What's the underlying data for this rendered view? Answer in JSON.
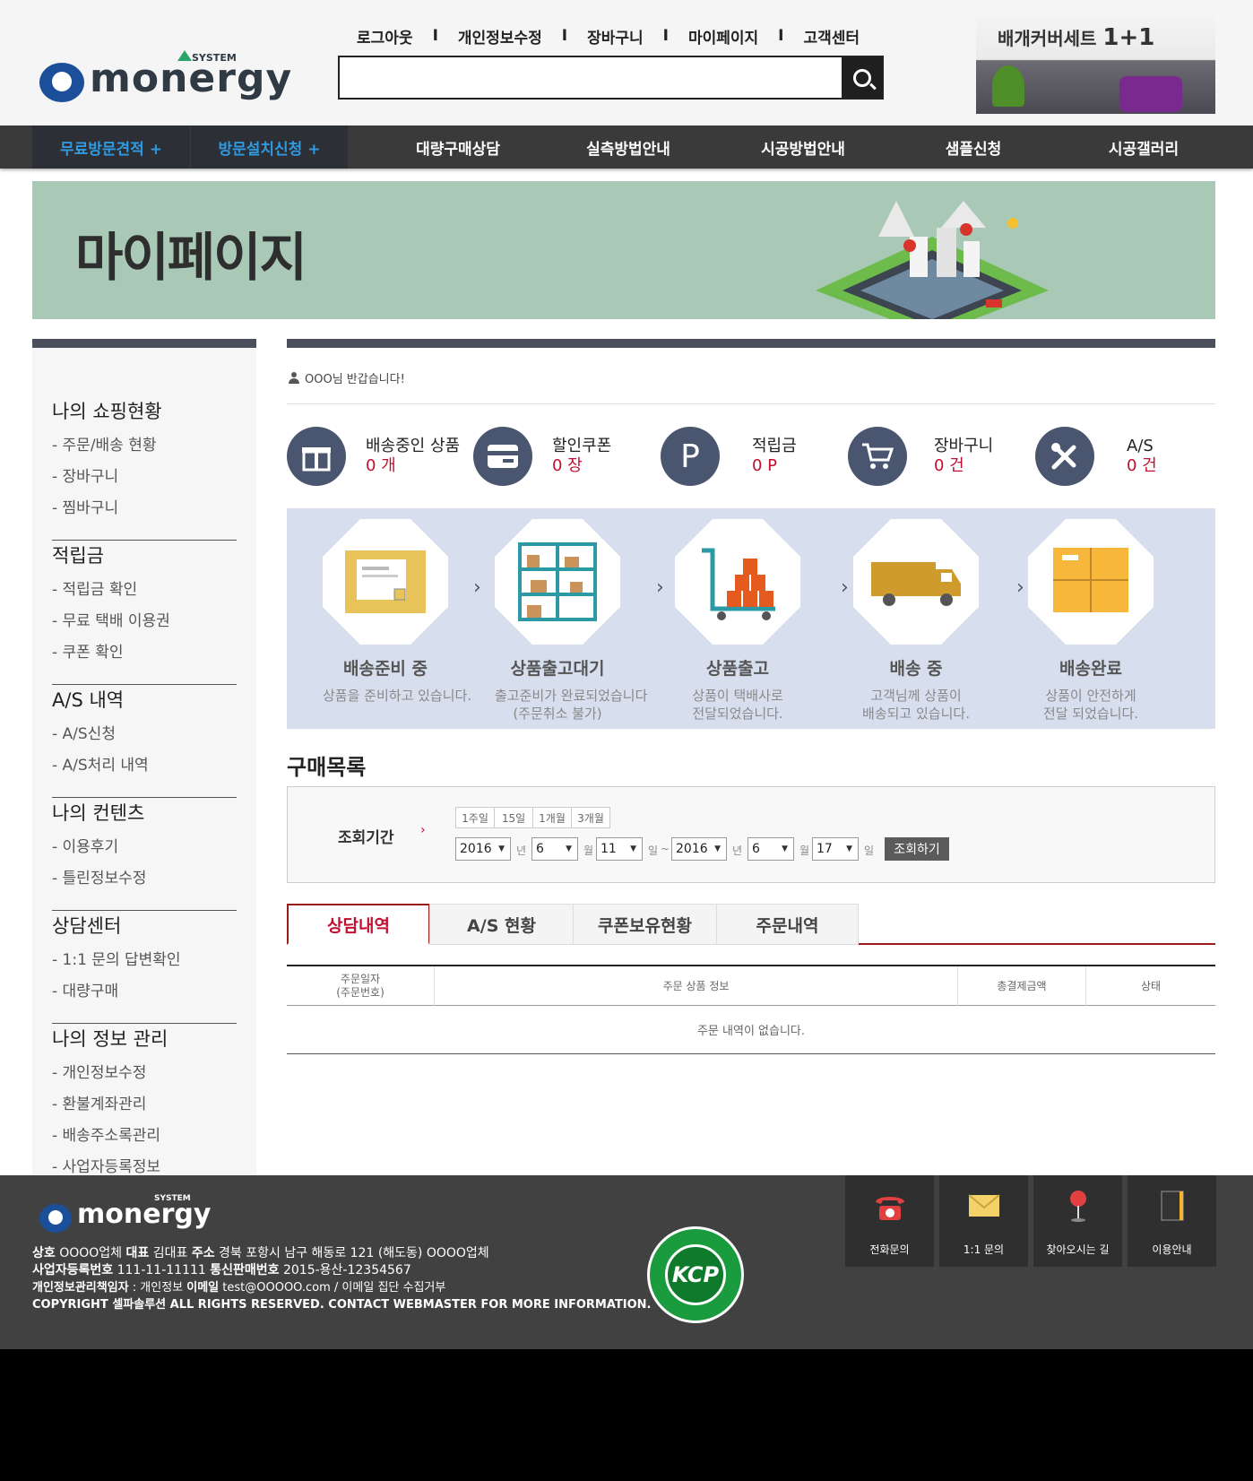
{
  "header": {
    "logo_text": "monergy",
    "logo_badge": "SYSTEM",
    "top_links": [
      "로그아웃",
      "개인정보수정",
      "장바구니",
      "마이페이지",
      "고객센터"
    ],
    "search": {
      "value": "",
      "placeholder": ""
    },
    "ad": {
      "text": "배개커버세트",
      "highlight": "1+1"
    }
  },
  "main_nav": {
    "highlight_items": [
      "무료방문견적 +",
      "방문설치신청 +"
    ],
    "items": [
      "대량구매상담",
      "실측방법안내",
      "시공방법안내",
      "샘플신청",
      "시공갤러리"
    ],
    "highlight_color": "#2f9ae0"
  },
  "banner": {
    "title": "마이페이지"
  },
  "sidebar": {
    "sections": [
      {
        "title": "나의 쇼핑현황",
        "items": [
          "- 주문/배송 현황",
          "- 장바구니",
          "- 찜바구니"
        ]
      },
      {
        "title": "적립금",
        "items": [
          "- 적립금 확인",
          "- 무료 택배 이용권",
          "- 쿠폰 확인"
        ]
      },
      {
        "title": "A/S 내역",
        "items": [
          "- A/S신청",
          "- A/S처리 내역"
        ]
      },
      {
        "title": "나의 컨텐츠",
        "items": [
          "- 이용후기",
          "- 틀린정보수정"
        ]
      },
      {
        "title": "상담센터",
        "items": [
          "- 1:1 문의 답변확인",
          "- 대량구매"
        ]
      },
      {
        "title": "나의 정보 관리",
        "items": [
          "- 개인정보수정",
          "- 환불계좌관리",
          "- 배송주소록관리",
          "- 사업자등록정보"
        ]
      }
    ]
  },
  "welcome": "OOO님 반갑습니다!",
  "stats": [
    {
      "icon": "gift-icon",
      "label": "배송중인 상품",
      "value": "0 개"
    },
    {
      "icon": "card-icon",
      "label": "할인쿠폰",
      "value": "0 장"
    },
    {
      "icon": "points-icon",
      "glyph": "P",
      "label": "적립금",
      "value": "0 P"
    },
    {
      "icon": "cart-icon",
      "label": "장바구니",
      "value": "0 건"
    },
    {
      "icon": "tools-icon",
      "label": "A/S",
      "value": "0 건"
    }
  ],
  "steps": [
    {
      "title": "배송준비 중",
      "desc1": "상품을 준비하고 있습니다.",
      "desc2": ""
    },
    {
      "title": "상품출고대기",
      "desc1": "출고준비가 완료되었습니다",
      "desc2": "(주문취소 불가)"
    },
    {
      "title": "상품출고",
      "desc1": "상품이 택배사로",
      "desc2": "전달되었습니다."
    },
    {
      "title": "배송 중",
      "desc1": "고객님께 상품이",
      "desc2": "배송되고 있습니다."
    },
    {
      "title": "배송완료",
      "desc1": "상품이 안전하게",
      "desc2": "전달 되었습니다."
    }
  ],
  "purchase": {
    "title": "구매목록",
    "filter_label": "조회기간",
    "quick": [
      "1주일",
      "15일",
      "1개월",
      "3개월"
    ],
    "from": {
      "year": "2016",
      "month": "6",
      "day": "11"
    },
    "to": {
      "year": "2016",
      "month": "6",
      "day": "17"
    },
    "units": {
      "year": "년",
      "month": "월",
      "day": "일",
      "tilde": "~"
    },
    "search_btn": "조회하기"
  },
  "tabs": [
    "상담내역",
    "A/S 현황",
    "쿠폰보유현황",
    "주문내역"
  ],
  "table": {
    "headers": [
      "주문일자",
      "(주문번호)",
      "주문 상품 정보",
      "총결제금액",
      "상태"
    ],
    "empty": "주문 내역이 없습니다."
  },
  "footer": {
    "logo_text": "monergy",
    "logo_badge": "SYSTEM",
    "line1_a": "상호",
    "line1_b": " OOOO업체 ",
    "line1_c": "대표",
    "line1_d": " 김대표 ",
    "line1_e": "주소",
    "line1_f": " 경북 포항시 남구 해동로 121 (해도동) OOOO업체",
    "line2_a": "사업자등록번호",
    "line2_b": " 111-11-11111 ",
    "line2_c": "통신판매번호",
    "line2_d": " 2015-용산-12354567",
    "line3_a": "개인정보관리책임자",
    "line3_b": " : 개인정보 ",
    "line3_c": "이메일",
    "line3_d": " test@OOOOO.com / 이메일 집단 수집거부",
    "line4": "COPYRIGHT 셀파솔루션 ALL RIGHTS RESERVED. CONTACT WEBMASTER FOR MORE INFORMATION.",
    "kcp": "KCP",
    "quick_links": [
      {
        "icon": "phone-icon",
        "label": "전화문의"
      },
      {
        "icon": "mail-icon",
        "label": "1:1 문의"
      },
      {
        "icon": "map-pin-icon",
        "label": "찾아오시는 길"
      },
      {
        "icon": "book-icon",
        "label": "이용안내"
      }
    ]
  }
}
